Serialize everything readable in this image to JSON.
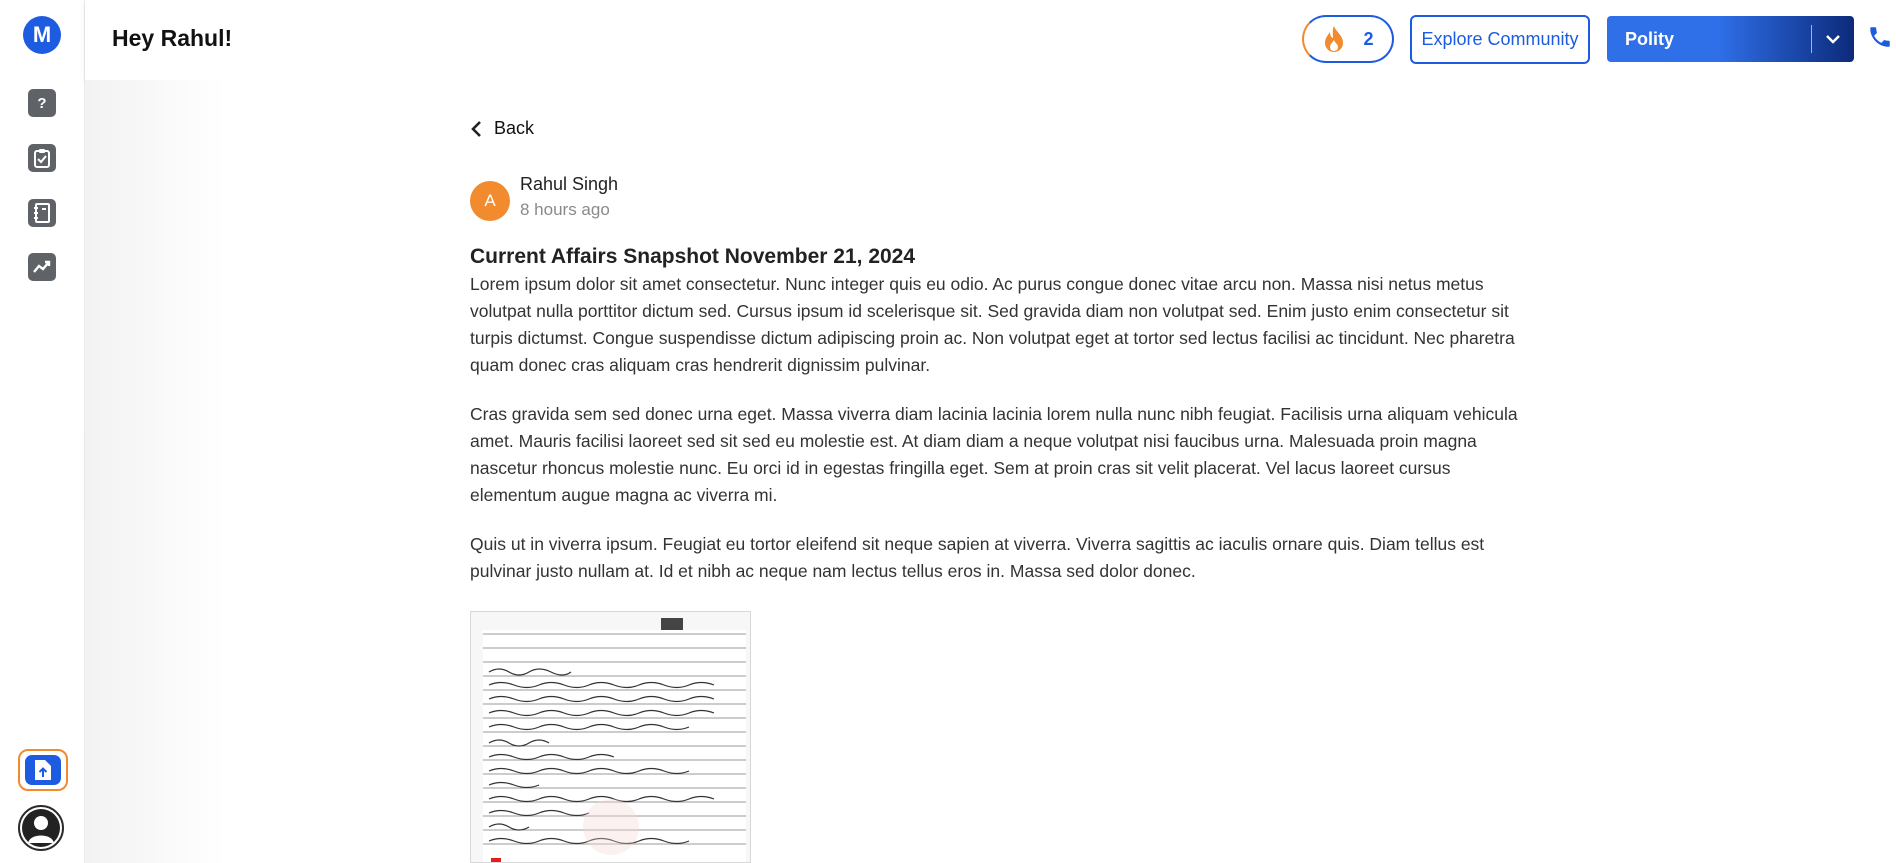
{
  "header": {
    "greeting": "Hey Rahul!",
    "streak_count": "2",
    "explore_label": "Explore Community",
    "subject_selected": "Polity"
  },
  "sidebar": {
    "logo_letter": "M",
    "items": [
      {
        "icon": "question-icon",
        "glyph": "?"
      },
      {
        "icon": "clipboard-check-icon",
        "glyph": "✓"
      },
      {
        "icon": "notebook-icon",
        "glyph": "≡"
      },
      {
        "icon": "trend-chart-icon",
        "glyph": "↗"
      }
    ]
  },
  "post": {
    "back_label": "Back",
    "author_initial": "A",
    "author_name": "Rahul Singh",
    "time_ago": "8 hours ago",
    "title": "Current Affairs Snapshot November 21, 2024",
    "paragraphs": [
      "Lorem ipsum dolor sit amet consectetur. Nunc integer quis eu odio. Ac purus congue donec vitae arcu non. Massa nisi netus metus volutpat nulla porttitor dictum sed. Cursus ipsum id scelerisque sit. Sed gravida diam non volutpat sed. Enim justo enim consectetur sit turpis dictumst. Congue suspendisse dictum adipiscing proin ac. Non volutpat eget at tortor sed lectus facilisi ac tincidunt. Nec pharetra quam donec cras aliquam cras hendrerit dignissim pulvinar.",
      "Cras gravida sem sed donec urna eget. Massa viverra diam lacinia lacinia lorem nulla nunc nibh feugiat. Facilisis urna aliquam vehicula amet. Mauris facilisi laoreet sed sit sed eu molestie est. At diam diam a neque volutpat nisi faucibus urna. Malesuada proin magna nascetur rhoncus molestie nunc. Eu orci id in egestas fringilla eget. Sem at proin cras sit velit placerat. Vel lacus laoreet cursus elementum augue magna ac viverra mi.",
      "Quis ut in viverra ipsum. Feugiat eu tortor eleifend sit neque sapien at viverra. Viverra sagittis ac iaculis ornare quis. Diam tellus est pulvinar justo nullam at. Id et nibh ac neque nam lectus tellus eros in. Massa sed dolor donec."
    ],
    "attachment_icon": "handwritten-notes-image"
  },
  "colors": {
    "brand_blue": "#1d5ce0",
    "accent_orange": "#f28a2e",
    "dark_navy": "#0c2a7a"
  }
}
